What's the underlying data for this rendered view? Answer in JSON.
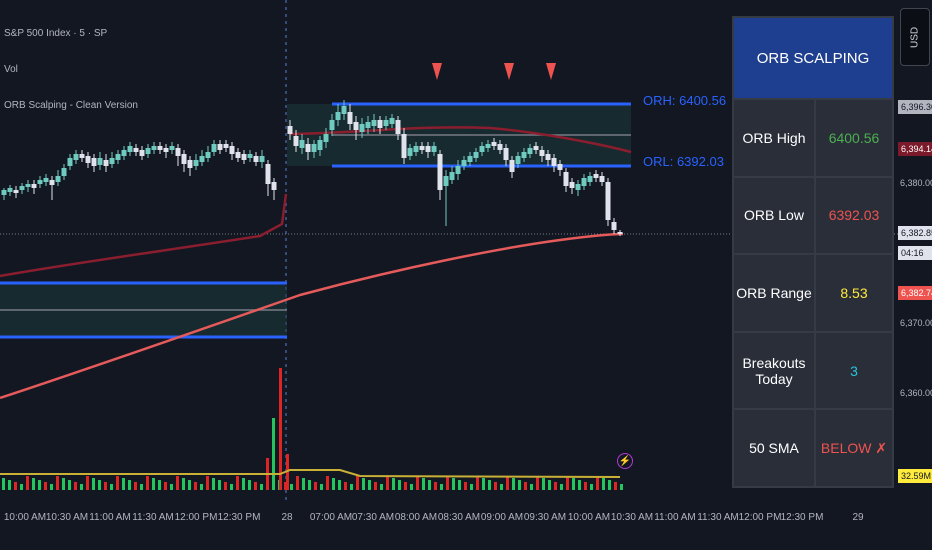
{
  "legend": {
    "symbol": "S&P 500 Index · 5 · SP",
    "vol": "Vol",
    "indicator": "ORB Scalping - Clean Version"
  },
  "orb_labels": {
    "high": "ORH: 6400.56",
    "low": "ORL: 6392.03"
  },
  "panel": {
    "title": "ORB SCALPING",
    "rows": [
      {
        "label": "ORB High",
        "value": "6400.56",
        "color": "#4caf50"
      },
      {
        "label": "ORB Low",
        "value": "6392.03",
        "color": "#ef5350"
      },
      {
        "label": "ORB Range",
        "value": "8.53",
        "color": "#ffeb3b"
      },
      {
        "label": "Breakouts Today",
        "value": "3",
        "color": "#26c6da"
      },
      {
        "label": "50 SMA",
        "value": "BELOW ✗",
        "color": "#ef5350"
      }
    ]
  },
  "price_axis": {
    "currency": "USD",
    "levels": [
      "6,380.00",
      "6,370.00",
      "6,360.00"
    ],
    "tags": [
      {
        "text": "6,396.30",
        "bg": "#b2b5be",
        "fg": "#131722"
      },
      {
        "text": "6,394.14",
        "bg": "#7b1a2b",
        "fg": "#ffffff"
      },
      {
        "text": "6,382.85",
        "bg": "#e0e3eb",
        "fg": "#131722"
      },
      {
        "text": "04:16",
        "bg": "#e0e3eb",
        "fg": "#131722"
      },
      {
        "text": "6,382.74",
        "bg": "#ef5350",
        "fg": "#ffffff"
      },
      {
        "text": "32.59M",
        "bg": "#ffeb3b",
        "fg": "#131722"
      }
    ]
  },
  "time_axis": [
    "10:00 AM",
    "10:30 AM",
    "11:00 AM",
    "11:30 AM",
    "12:00 PM",
    "12:30 PM",
    "28",
    "07:00 AM",
    "07:30 AM",
    "08:00 AM",
    "08:30 AM",
    "09:00 AM",
    "09:30 AM",
    "10:00 AM",
    "10:30 AM",
    "11:00 AM",
    "11:30 AM",
    "12:00 PM",
    "12:30 PM",
    "29"
  ],
  "colors": {
    "up": "#6fcbc0",
    "down": "#e0e3eb",
    "orb": "#2962ff",
    "sma_fast": "#8b1e2e",
    "sma_slow": "#e55a5a",
    "vol_up": "#22c55e",
    "vol_down": "#dc2626",
    "signal": "#ef5350"
  }
}
